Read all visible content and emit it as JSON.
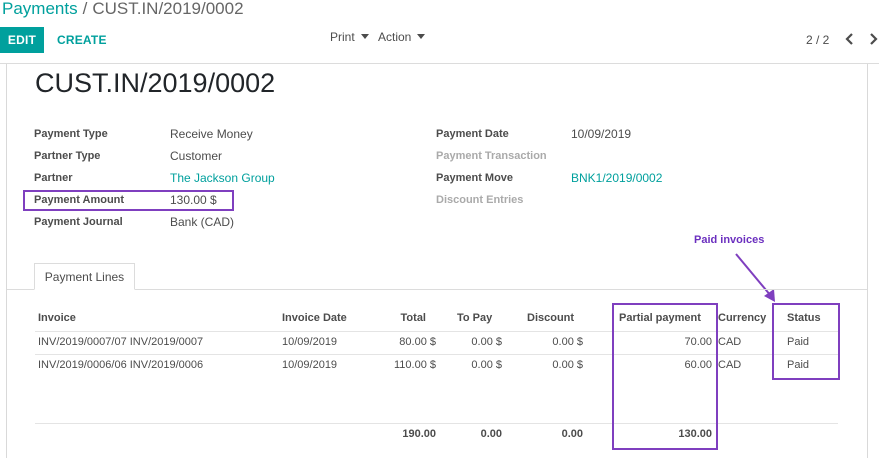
{
  "breadcrumb": {
    "parent": "Payments",
    "separator": "/",
    "current": "CUST.IN/2019/0002"
  },
  "buttons": {
    "edit": "EDIT",
    "create": "CREATE"
  },
  "toolbar": {
    "print": "Print",
    "action": "Action"
  },
  "pager": {
    "value": "2 / 2"
  },
  "record": {
    "title": "CUST.IN/2019/0002",
    "left_fields": [
      {
        "label": "Payment Type",
        "value": "Receive Money"
      },
      {
        "label": "Partner Type",
        "value": "Customer"
      },
      {
        "label": "Partner",
        "value": "The Jackson Group"
      },
      {
        "label": "Payment Amount",
        "value": "130.00 $"
      },
      {
        "label": "Payment Journal",
        "value": "Bank (CAD)"
      }
    ],
    "right_fields": [
      {
        "label": "Payment Date",
        "value": "10/09/2019"
      },
      {
        "label": "Payment Transaction",
        "value": ""
      },
      {
        "label": "Payment Move",
        "value": "BNK1/2019/0002"
      },
      {
        "label": "Discount Entries",
        "value": ""
      }
    ]
  },
  "annotation": {
    "paid_invoices": "Paid invoices",
    "color": "#7f3fbf"
  },
  "tabs": {
    "payment_lines": "Payment Lines"
  },
  "table": {
    "headers": [
      "Invoice",
      "Invoice Date",
      "Total",
      "To Pay",
      "Discount",
      "Partial payment",
      "Currency",
      "Status"
    ],
    "rows": [
      [
        "INV/2019/0007/07 INV/2019/0007",
        "10/09/2019",
        "80.00 $",
        "0.00 $",
        "0.00 $",
        "70.00",
        "CAD",
        "Paid"
      ],
      [
        "INV/2019/0006/06 INV/2019/0006",
        "10/09/2019",
        "110.00 $",
        "0.00 $",
        "0.00 $",
        "60.00",
        "CAD",
        "Paid"
      ]
    ],
    "footer": {
      "total": "190.00",
      "to_pay": "0.00",
      "discount": "0.00",
      "partial_payment": "130.00"
    }
  },
  "colors": {
    "accent": "#00a09d",
    "highlight": "#7f3fbf"
  }
}
